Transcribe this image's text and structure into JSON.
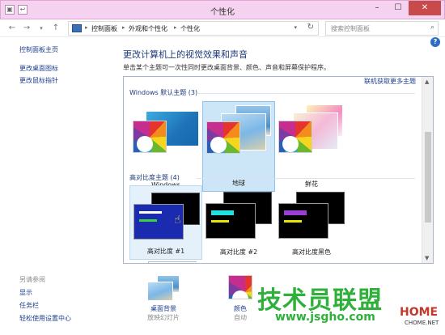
{
  "window": {
    "title": "个性化",
    "minimize": "–",
    "maximize": "☐",
    "close": "✕",
    "qat_icon_1": "▣",
    "qat_icon_2": "↩"
  },
  "nav": {
    "back": "←",
    "forward": "→",
    "up": "↑",
    "breadcrumbs": [
      "控制面板",
      "外观和个性化",
      "个性化"
    ],
    "search_placeholder": "搜索控制面板",
    "refresh": "↻",
    "dropdown": "▾"
  },
  "sidebar": {
    "home": "控制面板主页",
    "links": [
      "更改桌面图标",
      "更改鼠标指针"
    ],
    "see_also_title": "另请参阅",
    "see_also": [
      "显示",
      "任务栏",
      "轻松使用设置中心"
    ]
  },
  "main": {
    "heading": "更改计算机上的视觉效果和声音",
    "description": "单击某个主题可一次性同时更改桌面背景、颜色、声音和屏幕保护程序。",
    "get_more": "联机获取更多主题",
    "windows_section": "Windows 默认主题 (3)",
    "windows_themes": [
      "Windows",
      "地球",
      "鲜花"
    ],
    "hc_section": "高对比度主题 (4)",
    "hc_themes": [
      "高对比度 #1",
      "高对比度 #2",
      "高对比度黑色"
    ],
    "hc_colors": [
      {
        "bar1": "#ffffff",
        "bar2": "#3dd13d",
        "box": "#1a2bb0"
      },
      {
        "bar1": "#20e0e0",
        "bar2": "#e6e600",
        "box": "#000000"
      },
      {
        "bar1": "#9a3fd6",
        "bar2": "#e6e600",
        "box": "#000000"
      }
    ]
  },
  "bottom": {
    "items": [
      {
        "label": "桌面背景",
        "sub": "放映幻灯片"
      },
      {
        "label": "颜色",
        "sub": "自动"
      }
    ]
  },
  "help_icon": "?",
  "watermark": {
    "text": "技术员联盟",
    "url": "www.jsgho.com",
    "logo": "HOME",
    "logo_sub": "CHOME.NET"
  }
}
